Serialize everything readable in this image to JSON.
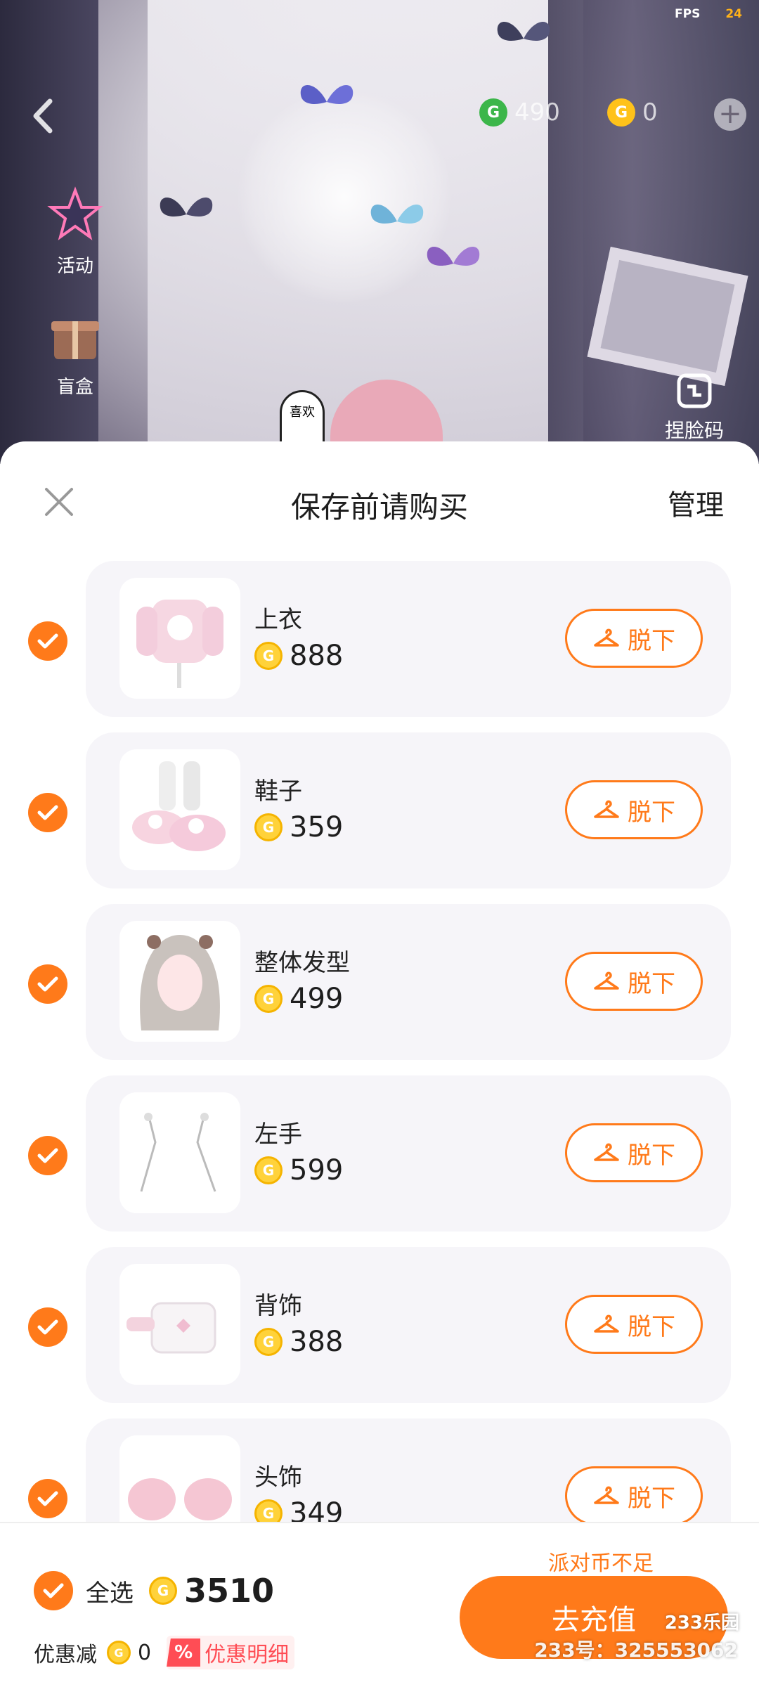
{
  "status": {
    "fps_label": "FPS",
    "fps_value": "24"
  },
  "top_bar": {
    "green_coin_count": "490",
    "gold_coin_count": "0",
    "add_label": "+"
  },
  "side_menu": [
    {
      "label": "活动",
      "icon": "star-icon"
    },
    {
      "label": "盲盒",
      "icon": "gift-box-icon"
    }
  ],
  "face_code_label": "捏脸码",
  "speech_bubble": "喜欢",
  "sheet": {
    "title": "保存前请购买",
    "manage_label": "管理",
    "take_off_label": "脱下",
    "items": [
      {
        "name": "上衣",
        "price": "888",
        "checked": true,
        "thumb": "pink-sweater"
      },
      {
        "name": "鞋子",
        "price": "359",
        "checked": true,
        "thumb": "kitty-slippers"
      },
      {
        "name": "整体发型",
        "price": "499",
        "checked": true,
        "thumb": "hairstyle"
      },
      {
        "name": "左手",
        "price": "599",
        "checked": true,
        "thumb": "left-hand-chains"
      },
      {
        "name": "背饰",
        "price": "388",
        "checked": true,
        "thumb": "bag"
      },
      {
        "name": "头饰",
        "price": "349",
        "checked": true,
        "thumb": "ear-pads"
      }
    ]
  },
  "footer": {
    "select_all_label": "全选",
    "total": "3510",
    "discount_label": "优惠减",
    "discount_amount": "0",
    "detail_percent": "%",
    "detail_label": "优惠明细",
    "insufficient_label": "派对币不足",
    "recharge_label": "去充值"
  },
  "watermark": {
    "logo": "233乐园",
    "id": "233号：325553062"
  },
  "colors": {
    "accent": "#ff7a1a",
    "coin": "#ffd23a",
    "danger": "#ff4d55"
  }
}
